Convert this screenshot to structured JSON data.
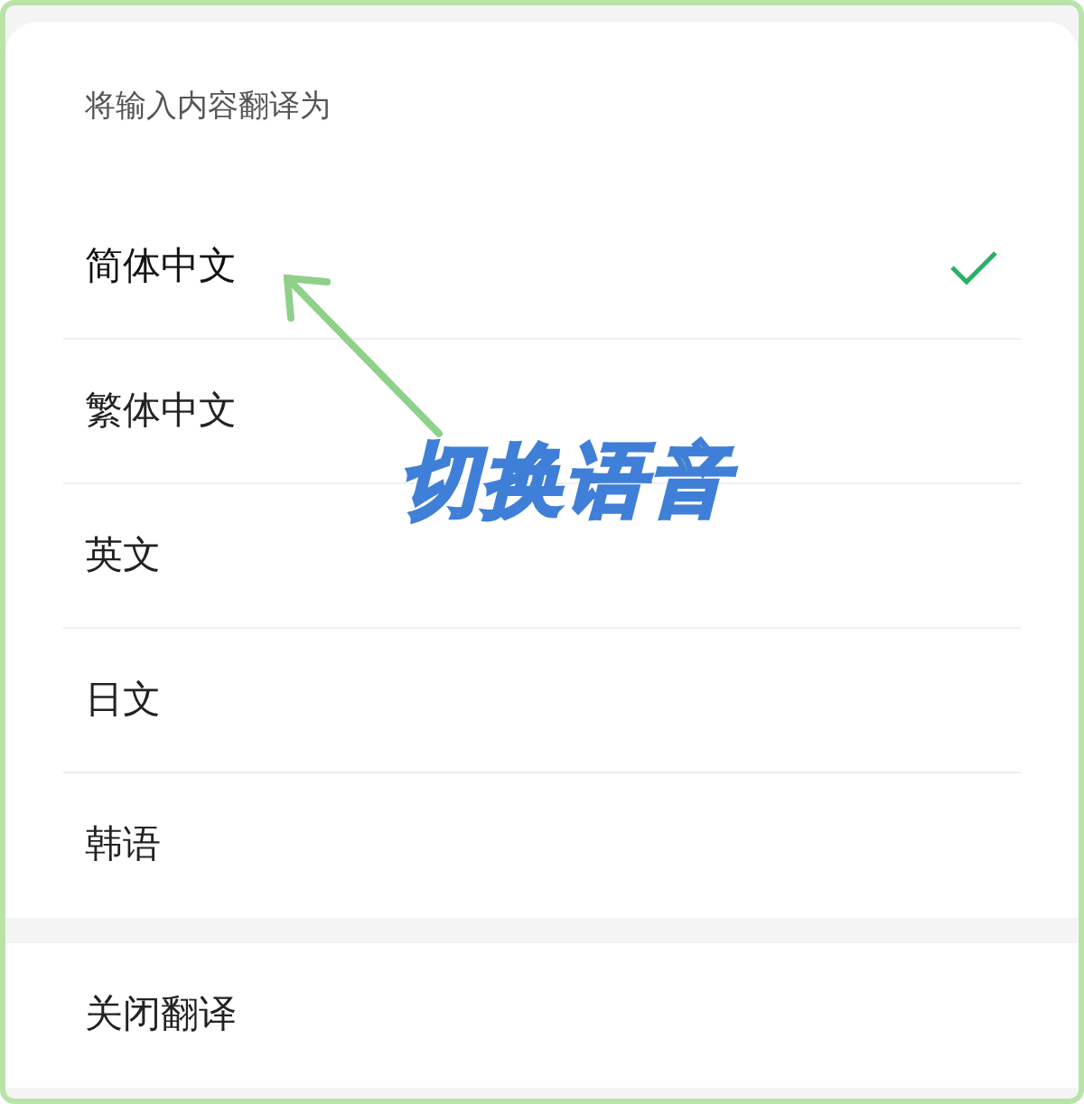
{
  "title": "将输入内容翻译为",
  "options": [
    {
      "label": "简体中文",
      "selected": true
    },
    {
      "label": "繁体中文",
      "selected": false
    },
    {
      "label": "英文",
      "selected": false
    },
    {
      "label": "日文",
      "selected": false
    },
    {
      "label": "韩语",
      "selected": false
    }
  ],
  "close_button": "关闭翻译",
  "annotation": {
    "text": "切换语音"
  }
}
